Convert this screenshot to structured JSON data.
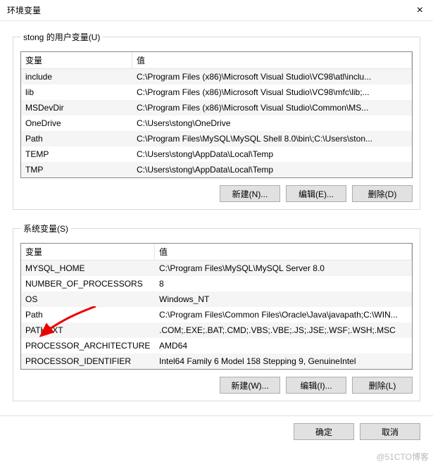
{
  "window": {
    "title": "环境变量"
  },
  "userSection": {
    "legend": "stong 的用户变量(U)",
    "headers": {
      "name": "变量",
      "value": "值"
    },
    "rows": [
      {
        "name": "include",
        "value": "C:\\Program Files (x86)\\Microsoft Visual Studio\\VC98\\atl\\inclu..."
      },
      {
        "name": "lib",
        "value": "C:\\Program Files (x86)\\Microsoft Visual Studio\\VC98\\mfc\\lib;..."
      },
      {
        "name": "MSDevDir",
        "value": "C:\\Program Files (x86)\\Microsoft Visual Studio\\Common\\MS..."
      },
      {
        "name": "OneDrive",
        "value": "C:\\Users\\stong\\OneDrive"
      },
      {
        "name": "Path",
        "value": "C:\\Program Files\\MySQL\\MySQL Shell 8.0\\bin\\;C:\\Users\\ston..."
      },
      {
        "name": "TEMP",
        "value": "C:\\Users\\stong\\AppData\\Local\\Temp"
      },
      {
        "name": "TMP",
        "value": "C:\\Users\\stong\\AppData\\Local\\Temp"
      }
    ],
    "buttons": {
      "new": "新建(N)...",
      "edit": "编辑(E)...",
      "del": "删除(D)"
    }
  },
  "systemSection": {
    "legend": "系统变量(S)",
    "headers": {
      "name": "变量",
      "value": "值"
    },
    "rows": [
      {
        "name": "MYSQL_HOME",
        "value": "C:\\Program Files\\MySQL\\MySQL Server 8.0"
      },
      {
        "name": "NUMBER_OF_PROCESSORS",
        "value": "8"
      },
      {
        "name": "OS",
        "value": "Windows_NT"
      },
      {
        "name": "Path",
        "value": "C:\\Program Files\\Common Files\\Oracle\\Java\\javapath;C:\\WIN..."
      },
      {
        "name": "PATHEXT",
        "value": ".COM;.EXE;.BAT;.CMD;.VBS;.VBE;.JS;.JSE;.WSF;.WSH;.MSC"
      },
      {
        "name": "PROCESSOR_ARCHITECTURE",
        "value": "AMD64"
      },
      {
        "name": "PROCESSOR_IDENTIFIER",
        "value": "Intel64 Family 6 Model 158 Stepping 9, GenuineIntel"
      }
    ],
    "buttons": {
      "new": "新建(W)...",
      "edit": "编辑(I)...",
      "del": "删除(L)"
    }
  },
  "dialog": {
    "ok": "确定",
    "cancel": "取消"
  },
  "watermark": "@51CTO博客"
}
